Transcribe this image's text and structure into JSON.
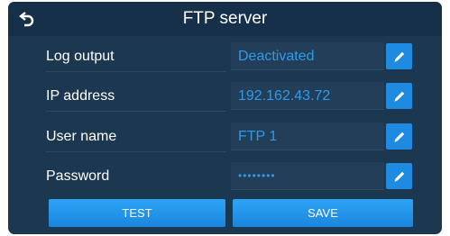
{
  "header": {
    "title": "FTP server"
  },
  "rows": [
    {
      "label": "Log output",
      "value": "Deactivated"
    },
    {
      "label": "IP address",
      "value": "192.162.43.72"
    },
    {
      "label": "User name",
      "value": "FTP 1"
    },
    {
      "label": "Password",
      "value": "••••••••"
    }
  ],
  "buttons": {
    "test": "TEST",
    "save": "SAVE"
  },
  "colors": {
    "background": "#1c3850",
    "header": "#16304a",
    "accent": "#1e8ae0",
    "value_text": "#2f9be8"
  },
  "icons": {
    "back": "back-arrow-icon",
    "edit": "pencil-icon"
  }
}
